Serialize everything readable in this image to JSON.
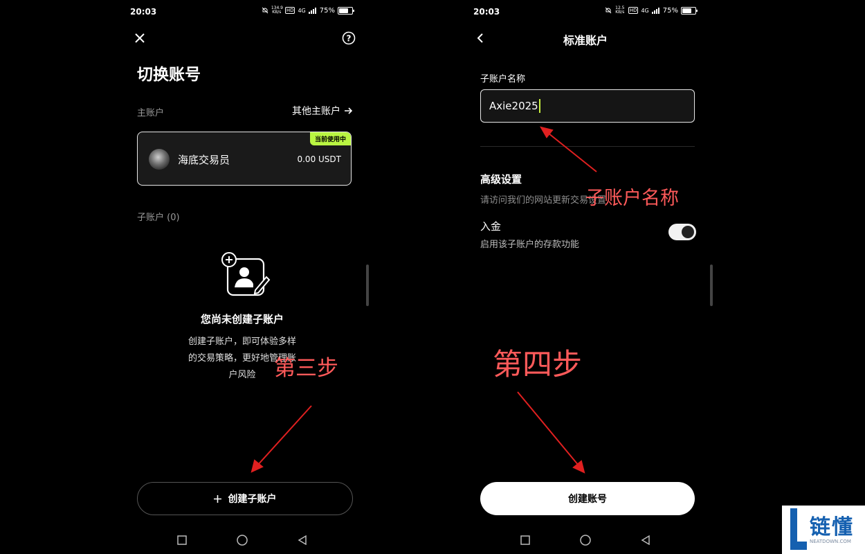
{
  "left": {
    "status": {
      "time": "20:03",
      "net_speed": "134.9 KB/s",
      "hd": "HD",
      "net_type": "4G",
      "battery": "75%"
    },
    "close_icon": "close-icon",
    "help_icon": "help-icon",
    "title": "切换账号",
    "main_account_label": "主账户",
    "other_main_accounts": "其他主账户",
    "account_card": {
      "name": "海底交易员",
      "balance": "0.00 USDT",
      "badge": "当前使用中"
    },
    "sub_accounts_label": "子账户 (0)",
    "empty_title": "您尚未创建子账户",
    "empty_desc_line1": "创建子账户，即可体验多样",
    "empty_desc_line2": "的交易策略，更好地管理账",
    "empty_desc_line3": "户风险",
    "create_button": "创建子账户",
    "annotation": "第三步"
  },
  "right": {
    "status": {
      "time": "20:03",
      "net_speed": "12.5 KB/s",
      "hd": "HD",
      "net_type": "4G",
      "battery": "75%"
    },
    "page_title": "标准账户",
    "field_label": "子账户名称",
    "field_value": "Axie2025",
    "advanced_title": "高级设置",
    "advanced_desc": "请访问我们的网站更新交易设置",
    "deposit_title": "入金",
    "deposit_desc": "启用该子账户的存款功能",
    "deposit_enabled": true,
    "create_button": "创建账号",
    "annotation_name": "子账户名称",
    "annotation_step": "第四步"
  },
  "watermark": {
    "text": "链懂",
    "sub": "NEATDOWN.COM"
  },
  "colors": {
    "accent": "#b9f542",
    "annotation": "#ff5a5a",
    "card_bg": "#1c1c1c"
  }
}
